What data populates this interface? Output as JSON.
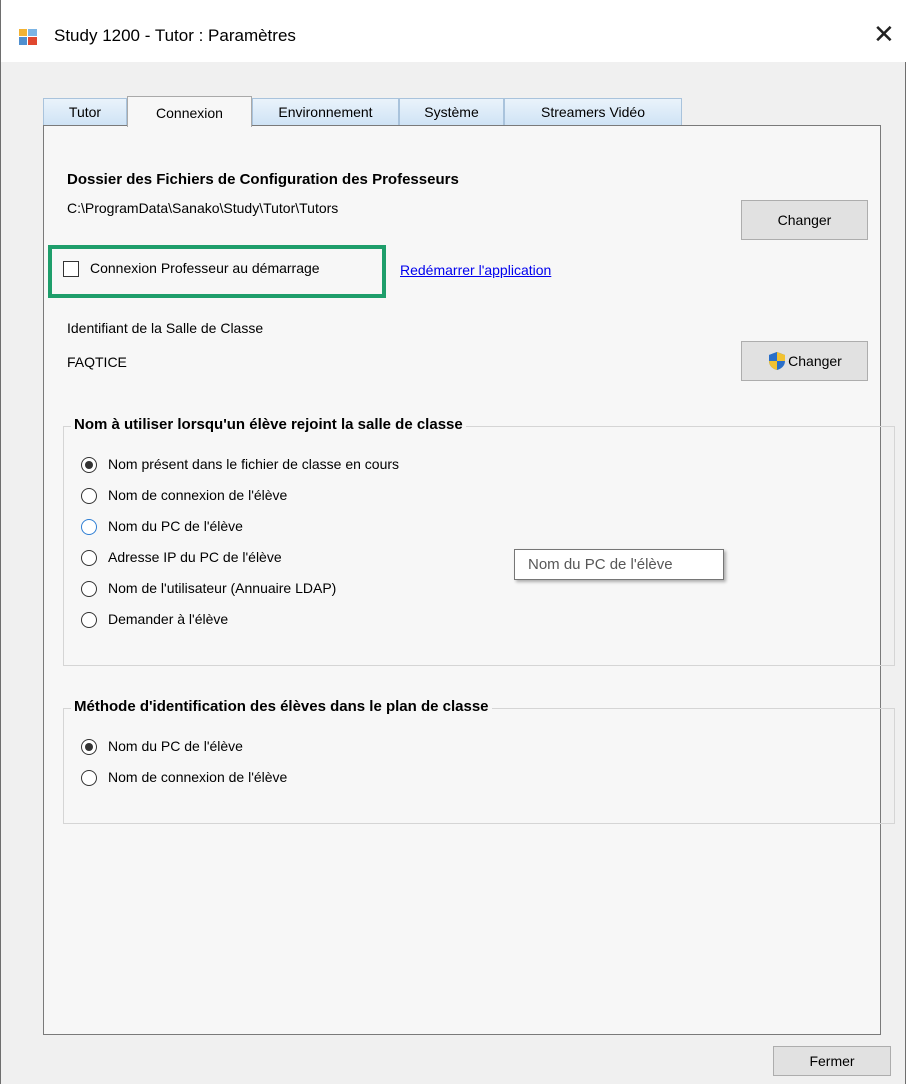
{
  "window": {
    "title": "Study 1200 - Tutor : Paramètres",
    "close_glyph": "✕"
  },
  "tabs": [
    {
      "label": "Tutor",
      "active": false
    },
    {
      "label": "Connexion",
      "active": true
    },
    {
      "label": "Environnement",
      "active": false
    },
    {
      "label": "Système",
      "active": false
    },
    {
      "label": "Streamers Vidéo",
      "active": false
    }
  ],
  "config_folder": {
    "heading": "Dossier des Fichiers de Configuration des Professeurs",
    "path": "C:\\ProgramData\\Sanako\\Study\\Tutor\\Tutors",
    "change_label": "Changer"
  },
  "teacher_login": {
    "checkbox_label": "Connexion Professeur au démarrage",
    "checked": false,
    "restart_link": "Redémarrer l'application"
  },
  "classroom": {
    "label": "Identifiant de la Salle de Classe",
    "value": "FAQTICE",
    "change_label": "Changer"
  },
  "student_name_group": {
    "legend": "Nom à utiliser lorsqu'un élève rejoint la salle de classe",
    "options": [
      {
        "label": "Nom présent dans le fichier de classe en cours",
        "checked": true
      },
      {
        "label": "Nom de connexion de l'élève",
        "checked": false
      },
      {
        "label": "Nom du PC de l'élève",
        "checked": false
      },
      {
        "label": "Adresse IP du PC de l'élève",
        "checked": false
      },
      {
        "label": "Nom de l'utilisateur (Annuaire LDAP)",
        "checked": false
      },
      {
        "label": "Demander à l'élève",
        "checked": false
      }
    ]
  },
  "tooltip": {
    "text": "Nom du PC de l'élève"
  },
  "identification_group": {
    "legend": "Méthode d'identification des élèves dans le plan de classe",
    "options": [
      {
        "label": "Nom du PC de l'élève",
        "checked": true
      },
      {
        "label": "Nom de connexion de l'élève",
        "checked": false
      }
    ]
  },
  "footer": {
    "close_label": "Fermer"
  },
  "colors": {
    "highlight": "#1e9e6b",
    "link": "#0000ee",
    "tab_inactive": "#cfe3f5"
  }
}
